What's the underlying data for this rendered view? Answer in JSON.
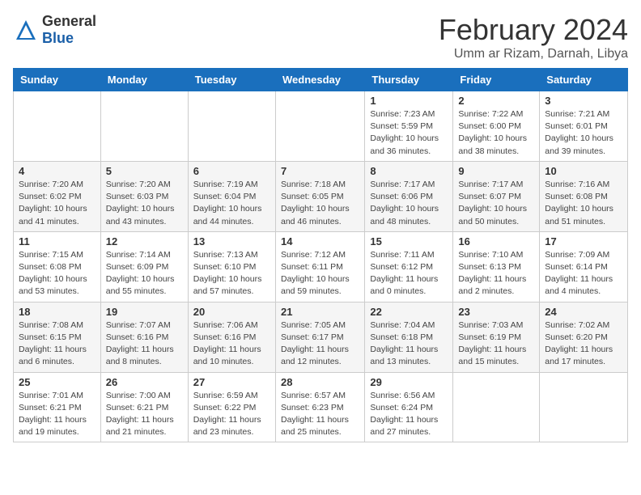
{
  "header": {
    "logo_general": "General",
    "logo_blue": "Blue",
    "month_title": "February 2024",
    "location": "Umm ar Rizam, Darnah, Libya"
  },
  "days_of_week": [
    "Sunday",
    "Monday",
    "Tuesday",
    "Wednesday",
    "Thursday",
    "Friday",
    "Saturday"
  ],
  "weeks": [
    [
      {
        "day": "",
        "info": ""
      },
      {
        "day": "",
        "info": ""
      },
      {
        "day": "",
        "info": ""
      },
      {
        "day": "",
        "info": ""
      },
      {
        "day": "1",
        "info": "Sunrise: 7:23 AM\nSunset: 5:59 PM\nDaylight: 10 hours\nand 36 minutes."
      },
      {
        "day": "2",
        "info": "Sunrise: 7:22 AM\nSunset: 6:00 PM\nDaylight: 10 hours\nand 38 minutes."
      },
      {
        "day": "3",
        "info": "Sunrise: 7:21 AM\nSunset: 6:01 PM\nDaylight: 10 hours\nand 39 minutes."
      }
    ],
    [
      {
        "day": "4",
        "info": "Sunrise: 7:20 AM\nSunset: 6:02 PM\nDaylight: 10 hours\nand 41 minutes."
      },
      {
        "day": "5",
        "info": "Sunrise: 7:20 AM\nSunset: 6:03 PM\nDaylight: 10 hours\nand 43 minutes."
      },
      {
        "day": "6",
        "info": "Sunrise: 7:19 AM\nSunset: 6:04 PM\nDaylight: 10 hours\nand 44 minutes."
      },
      {
        "day": "7",
        "info": "Sunrise: 7:18 AM\nSunset: 6:05 PM\nDaylight: 10 hours\nand 46 minutes."
      },
      {
        "day": "8",
        "info": "Sunrise: 7:17 AM\nSunset: 6:06 PM\nDaylight: 10 hours\nand 48 minutes."
      },
      {
        "day": "9",
        "info": "Sunrise: 7:17 AM\nSunset: 6:07 PM\nDaylight: 10 hours\nand 50 minutes."
      },
      {
        "day": "10",
        "info": "Sunrise: 7:16 AM\nSunset: 6:08 PM\nDaylight: 10 hours\nand 51 minutes."
      }
    ],
    [
      {
        "day": "11",
        "info": "Sunrise: 7:15 AM\nSunset: 6:08 PM\nDaylight: 10 hours\nand 53 minutes."
      },
      {
        "day": "12",
        "info": "Sunrise: 7:14 AM\nSunset: 6:09 PM\nDaylight: 10 hours\nand 55 minutes."
      },
      {
        "day": "13",
        "info": "Sunrise: 7:13 AM\nSunset: 6:10 PM\nDaylight: 10 hours\nand 57 minutes."
      },
      {
        "day": "14",
        "info": "Sunrise: 7:12 AM\nSunset: 6:11 PM\nDaylight: 10 hours\nand 59 minutes."
      },
      {
        "day": "15",
        "info": "Sunrise: 7:11 AM\nSunset: 6:12 PM\nDaylight: 11 hours\nand 0 minutes."
      },
      {
        "day": "16",
        "info": "Sunrise: 7:10 AM\nSunset: 6:13 PM\nDaylight: 11 hours\nand 2 minutes."
      },
      {
        "day": "17",
        "info": "Sunrise: 7:09 AM\nSunset: 6:14 PM\nDaylight: 11 hours\nand 4 minutes."
      }
    ],
    [
      {
        "day": "18",
        "info": "Sunrise: 7:08 AM\nSunset: 6:15 PM\nDaylight: 11 hours\nand 6 minutes."
      },
      {
        "day": "19",
        "info": "Sunrise: 7:07 AM\nSunset: 6:16 PM\nDaylight: 11 hours\nand 8 minutes."
      },
      {
        "day": "20",
        "info": "Sunrise: 7:06 AM\nSunset: 6:16 PM\nDaylight: 11 hours\nand 10 minutes."
      },
      {
        "day": "21",
        "info": "Sunrise: 7:05 AM\nSunset: 6:17 PM\nDaylight: 11 hours\nand 12 minutes."
      },
      {
        "day": "22",
        "info": "Sunrise: 7:04 AM\nSunset: 6:18 PM\nDaylight: 11 hours\nand 13 minutes."
      },
      {
        "day": "23",
        "info": "Sunrise: 7:03 AM\nSunset: 6:19 PM\nDaylight: 11 hours\nand 15 minutes."
      },
      {
        "day": "24",
        "info": "Sunrise: 7:02 AM\nSunset: 6:20 PM\nDaylight: 11 hours\nand 17 minutes."
      }
    ],
    [
      {
        "day": "25",
        "info": "Sunrise: 7:01 AM\nSunset: 6:21 PM\nDaylight: 11 hours\nand 19 minutes."
      },
      {
        "day": "26",
        "info": "Sunrise: 7:00 AM\nSunset: 6:21 PM\nDaylight: 11 hours\nand 21 minutes."
      },
      {
        "day": "27",
        "info": "Sunrise: 6:59 AM\nSunset: 6:22 PM\nDaylight: 11 hours\nand 23 minutes."
      },
      {
        "day": "28",
        "info": "Sunrise: 6:57 AM\nSunset: 6:23 PM\nDaylight: 11 hours\nand 25 minutes."
      },
      {
        "day": "29",
        "info": "Sunrise: 6:56 AM\nSunset: 6:24 PM\nDaylight: 11 hours\nand 27 minutes."
      },
      {
        "day": "",
        "info": ""
      },
      {
        "day": "",
        "info": ""
      }
    ]
  ]
}
